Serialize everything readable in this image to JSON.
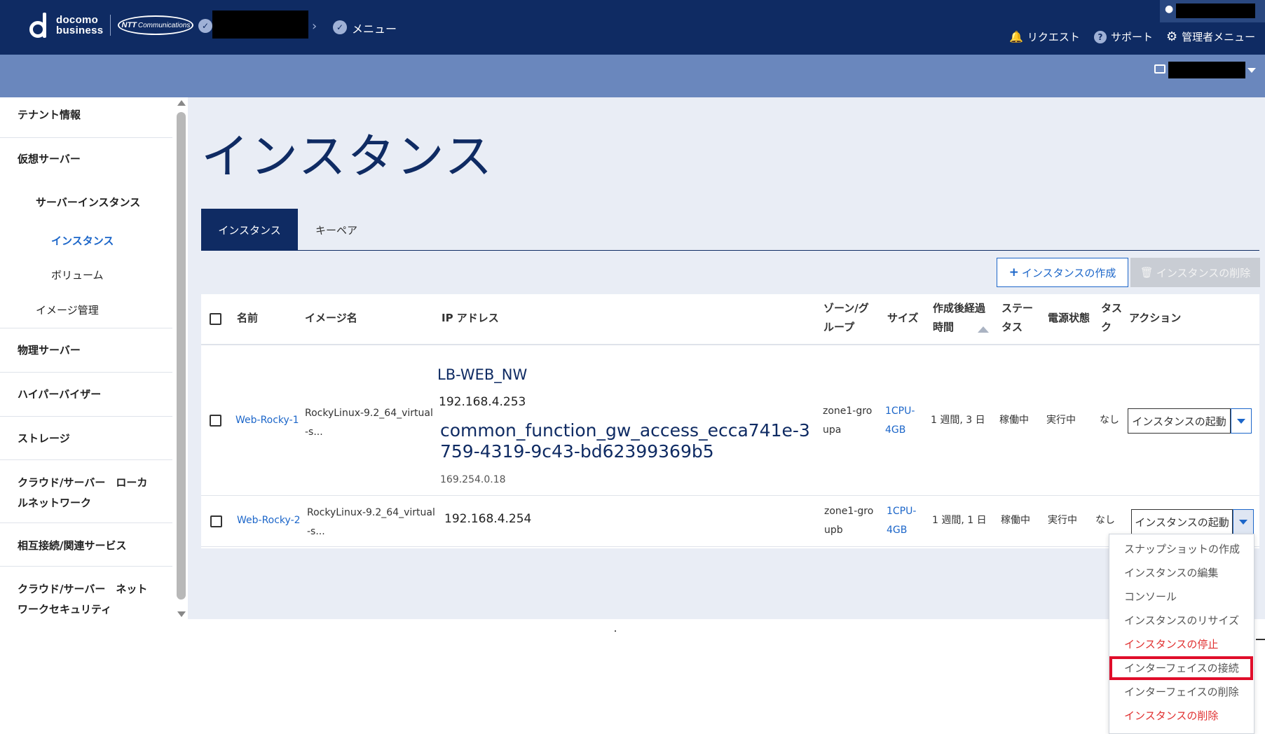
{
  "header": {
    "logo_line1": "docomo",
    "logo_line2": "business",
    "ntt_mark": "NTT",
    "ntt_sub": "Communications",
    "breadcrumb_menu": "メニュー",
    "nav_request": "リクエスト",
    "nav_support": "サポート",
    "nav_admin": "管理者メニュー"
  },
  "sidebar": {
    "items": [
      {
        "label": "テナント情報"
      },
      {
        "label": "仮想サーバー"
      },
      {
        "label": "サーバーインスタンス"
      },
      {
        "label": "インスタンス"
      },
      {
        "label": "ボリューム"
      },
      {
        "label": "イメージ管理"
      },
      {
        "label": "物理サーバー"
      },
      {
        "label": "ハイパーバイザー"
      },
      {
        "label": "ストレージ"
      },
      {
        "label": "クラウド/サーバー　ローカ"
      },
      {
        "label": "ルネットワーク"
      },
      {
        "label": "相互接続/関連サービス"
      },
      {
        "label": "クラウド/サーバー　ネット"
      },
      {
        "label": "ワークセキュリティ"
      }
    ]
  },
  "main": {
    "title": "インスタンス",
    "tabs": [
      {
        "label": "インスタンス"
      },
      {
        "label": "キーペア"
      }
    ],
    "create_button": "インスタンスの作成",
    "delete_button": "インスタンスの削除"
  },
  "table": {
    "headers": {
      "name": "名前",
      "image": "イメージ名",
      "ip": "IP アドレス",
      "zone_1": "ゾーン/グ",
      "zone_2": "ループ",
      "size": "サイズ",
      "elapsed_1": "作成後経過",
      "elapsed_2": "時間",
      "status_1": "ステー",
      "status_2": "タス",
      "power": "電源状態",
      "task_1": "タス",
      "task_2": "ク",
      "action": "アクション"
    },
    "rows": [
      {
        "name": "Web-Rocky-1",
        "image_1": "RockyLinux-9.2_64_virtual",
        "image_2": "-s...",
        "net1_name": "LB-WEB_NW",
        "net1_ip": "192.168.4.253",
        "net2_name_1": "common_function_gw_access_ecca741e-3",
        "net2_name_2": "759-4319-9c43-bd62399369b5",
        "net2_ip": "169.254.0.18",
        "zone_1": "zone1-gro",
        "zone_2": "upa",
        "size_1": "1CPU-",
        "size_2": "4GB",
        "elapsed": "1 週間, 3 日",
        "status": "稼働中",
        "power": "実行中",
        "task": "なし",
        "action": "インスタンスの起動"
      },
      {
        "name": "Web-Rocky-2",
        "image_1": "RockyLinux-9.2_64_virtual",
        "image_2": "-s...",
        "net1_ip": "192.168.4.254",
        "zone_1": "zone1-gro",
        "zone_2": "upb",
        "size_1": "1CPU-",
        "size_2": "4GB",
        "elapsed": "1 週間, 1 日",
        "status": "稼働中",
        "power": "実行中",
        "task": "なし",
        "action": "インスタンスの起動"
      }
    ]
  },
  "dropdown": {
    "items": [
      {
        "label": "スナップショットの作成"
      },
      {
        "label": "インスタンスの編集"
      },
      {
        "label": "コンソール"
      },
      {
        "label": "インスタンスのリサイズ"
      },
      {
        "label": "インスタンスの停止"
      },
      {
        "label": "インターフェイスの接続"
      },
      {
        "label": "インターフェイスの削除"
      },
      {
        "label": "インスタンスの削除"
      }
    ]
  },
  "colors": {
    "header_bg": "#0f2b63",
    "subbar_bg": "#6a87bd",
    "accent": "#1c66c9",
    "danger": "#e03030",
    "highlight": "#e00d2a"
  }
}
